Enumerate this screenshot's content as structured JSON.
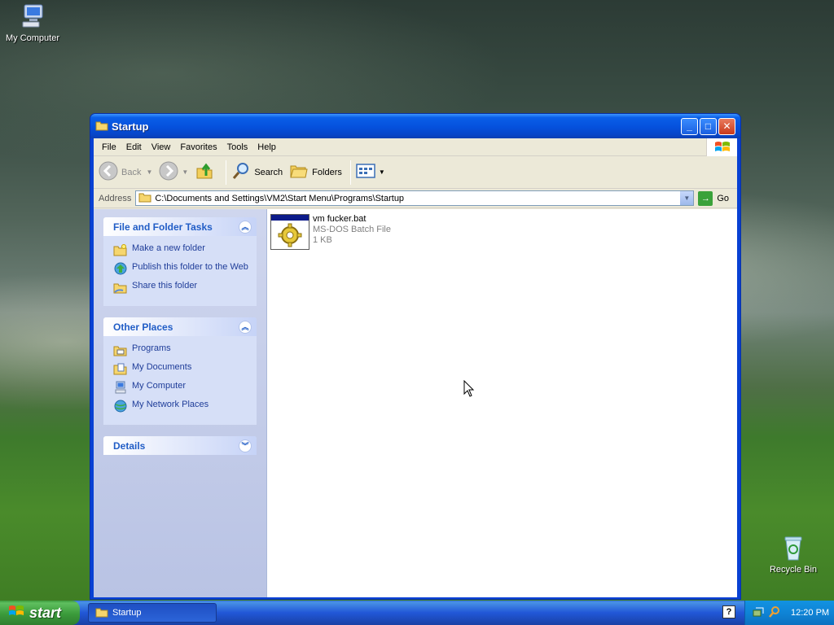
{
  "desktop": {
    "icons": [
      {
        "label": "My Computer"
      },
      {
        "label": "Recycle Bin"
      }
    ]
  },
  "window": {
    "title": "Startup",
    "menu": [
      "File",
      "Edit",
      "View",
      "Favorites",
      "Tools",
      "Help"
    ],
    "toolbar": {
      "back": "Back",
      "search": "Search",
      "folders": "Folders"
    },
    "address": {
      "label": "Address",
      "value": "C:\\Documents and Settings\\VM2\\Start Menu\\Programs\\Startup",
      "go": "Go"
    },
    "task_pane": {
      "file_tasks": {
        "title": "File and Folder Tasks",
        "items": [
          "Make a new folder",
          "Publish this folder to the Web",
          "Share this folder"
        ]
      },
      "other_places": {
        "title": "Other Places",
        "items": [
          "Programs",
          "My Documents",
          "My Computer",
          "My Network Places"
        ]
      },
      "details": {
        "title": "Details"
      }
    },
    "files": [
      {
        "name": "vm fucker.bat",
        "type": "MS-DOS Batch File",
        "size": "1 KB"
      }
    ]
  },
  "taskbar": {
    "start_label": "start",
    "task": "Startup",
    "clock": "12:20 PM"
  }
}
